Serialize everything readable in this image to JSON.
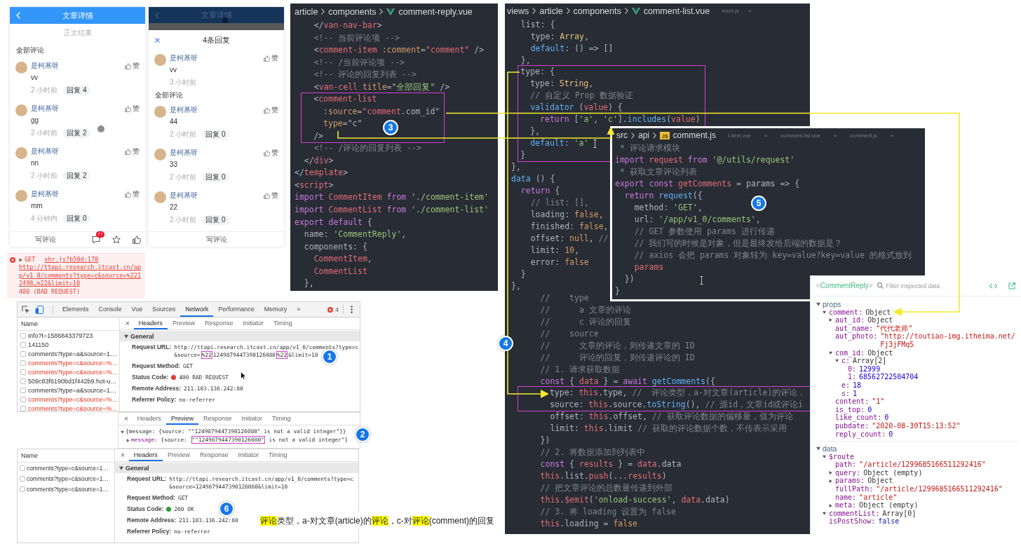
{
  "phone_article": {
    "title": "文章详情",
    "end_note": "正文结束",
    "section_title": "全部评论",
    "comments": [
      {
        "author": "是柯基呀",
        "like": "赞",
        "content": "vv",
        "time": "2 小时前",
        "reply": "回复 4"
      },
      {
        "author": "是柯基呀",
        "like": "赞",
        "content": "gg",
        "time": "2 小时前",
        "reply": "回复 2"
      },
      {
        "author": "是柯基呀",
        "like": "赞",
        "content": "nn",
        "time": "2 小时前",
        "reply": "回复 2"
      },
      {
        "author": "是柯基呀",
        "like": "赞",
        "content": "mm",
        "time": "4 分钟内",
        "reply": "回复 0"
      }
    ],
    "bottom_bar": {
      "write": "写评论",
      "comment_count": "77"
    }
  },
  "phone_replies": {
    "title": "文章详情",
    "popup_title": "4条回复",
    "current_comment": {
      "author": "是柯基呀",
      "like": "赞",
      "content": "vv",
      "time": "3 小时前"
    },
    "section_title": "全部评论",
    "replies": [
      {
        "author": "是柯基呀",
        "like": "赞",
        "content": "44",
        "time": "2 小时前",
        "reply": "回复 0"
      },
      {
        "author": "是柯基呀",
        "like": "赞",
        "content": "33",
        "time": "2 小时前",
        "reply": "回复 0"
      },
      {
        "author": "是柯基呀",
        "like": "赞",
        "content": "22",
        "time": "2 小时前",
        "reply": "回复 0"
      }
    ],
    "bottom_bar": {
      "write": "写评论"
    }
  },
  "console_error": {
    "expanded": false,
    "method": "GET",
    "source": "xhr.js?b50d:178",
    "url": "http://ttapi.research.itcast.cn/app/v1_0/comments?type=c&source=%2212498…%22&limit=10",
    "status": "400 (BAD REQUEST)"
  },
  "network_failed": {
    "tools": [
      {
        "label": "Elements",
        "selected": false
      },
      {
        "label": "Console",
        "selected": false
      },
      {
        "label": "Vue",
        "selected": false
      },
      {
        "label": "Sources",
        "selected": false
      },
      {
        "label": "Network",
        "selected": true
      },
      {
        "label": "Performance",
        "selected": false
      },
      {
        "label": "Memory",
        "selected": false
      }
    ],
    "more": "»",
    "error_count": "4",
    "name_header": "Name",
    "requests": [
      {
        "name": "info?t=1586843379723",
        "failed": false
      },
      {
        "name": "141150",
        "failed": false
      },
      {
        "name": "comments?type=a&source=1…",
        "failed": false
      },
      {
        "name": "comments?type=c&source=%…",
        "failed": true
      },
      {
        "name": "comments?type=c&source=%…",
        "failed": true
      },
      {
        "name": "509c83f6190bd1f442b9.hot-u…",
        "failed": false
      },
      {
        "name": "comments?type=a&source=1…",
        "failed": false
      },
      {
        "name": "comments?type=c&source=%…",
        "failed": true
      },
      {
        "name": "comments?type=c&source=%…",
        "failed": true
      }
    ],
    "close": "×",
    "detail_tabs": [
      {
        "label": "Headers",
        "selected": true
      },
      {
        "label": "Preview",
        "selected": false
      },
      {
        "label": "Response",
        "selected": false
      },
      {
        "label": "Initiator",
        "selected": false
      },
      {
        "label": "Timing",
        "selected": false
      }
    ],
    "general": {
      "title": "General",
      "expanded": true,
      "rows": [
        {
          "kind": "text",
          "label": "Request URL:",
          "value": [
            {
              "text": "http://ttapi.research.itcast.cn/app/v1_0/comments?type=c&source=",
              "highlight": false
            },
            {
              "text": "%22",
              "highlight": true
            },
            {
              "text": "1249879447390126080",
              "highlight": false
            },
            {
              "text": "%22",
              "highlight": true
            },
            {
              "text": "&limit=10",
              "highlight": false
            }
          ]
        },
        {
          "kind": "text",
          "label": "Request Method:",
          "value": [
            {
              "text": "GET",
              "highlight": false
            }
          ]
        },
        {
          "kind": "status",
          "label": "Status Code:",
          "color": "#e53935",
          "value": [
            {
              "text": "400 BAD REQUEST",
              "highlight": false
            }
          ]
        },
        {
          "kind": "text",
          "label": "Remote Address:",
          "value": [
            {
              "text": "211.103.136.242:80",
              "highlight": false
            }
          ]
        },
        {
          "kind": "text",
          "label": "Referrer Policy:",
          "value": [
            {
              "text": "no-referrer",
              "highlight": false
            }
          ]
        }
      ]
    }
  },
  "preview": {
    "close": "×",
    "detail_tabs": [
      {
        "label": "Headers",
        "selected": false
      },
      {
        "label": "Preview",
        "selected": true
      },
      {
        "label": "Response",
        "selected": false
      },
      {
        "label": "Initiator",
        "selected": false
      },
      {
        "label": "Timing",
        "selected": false
      }
    ],
    "lines": [
      {
        "expanded": true,
        "parts": [
          {
            "kind": "plain",
            "text": "{message: {source: \"\"1249879447390126080\" is not a valid integer\"}}",
            "highlight": false
          }
        ],
        "children": [
          {
            "expanded": false,
            "parts": [
              {
                "kind": "key",
                "text": "message",
                "highlight": false
              },
              {
                "kind": "plain",
                "text": ": {source: ",
                "highlight": false
              },
              {
                "kind": "plain",
                "text": "\"\"1249879447390126080\"",
                "highlight": true
              },
              {
                "kind": "plain",
                "text": " is not a valid integer\"}",
                "highlight": false
              }
            ]
          }
        ]
      }
    ]
  },
  "network_ok": {
    "name_header": "Name",
    "requests": [
      {
        "name": "comments?type=c&source=1…",
        "failed": false
      },
      {
        "name": "comments?type=c&source=1…",
        "failed": false
      },
      {
        "name": "comments?type=c&source=1…",
        "failed": false
      }
    ],
    "close": "×",
    "detail_tabs": [
      {
        "label": "Headers",
        "selected": true
      },
      {
        "label": "Preview",
        "selected": false
      },
      {
        "label": "Response",
        "selected": false
      },
      {
        "label": "Initiator",
        "selected": false
      },
      {
        "label": "Timing",
        "selected": false
      }
    ],
    "general": {
      "title": "General",
      "expanded": true,
      "rows": [
        {
          "kind": "text",
          "label": "Request URL:",
          "value": [
            {
              "text": "http://ttapi.research.itcast.cn/app/v1_0/comments?type=c&source=1249879447390126080&limit=10",
              "highlight": false
            }
          ]
        },
        {
          "kind": "text",
          "label": "Request Method:",
          "value": [
            {
              "text": "GET",
              "highlight": false
            }
          ]
        },
        {
          "kind": "status",
          "label": "Status Code:",
          "color": "#2e9d3a",
          "value": [
            {
              "text": "200 OK",
              "highlight": false
            }
          ]
        },
        {
          "kind": "text",
          "label": "Remote Address:",
          "value": [
            {
              "text": "211.103.136.242:80",
              "highlight": false
            }
          ]
        },
        {
          "kind": "text",
          "label": "Referrer Policy:",
          "value": [
            {
              "text": "no-referrer",
              "highlight": false
            }
          ]
        }
      ]
    }
  },
  "editor_reply": {
    "path": [
      "article",
      "components"
    ],
    "file_icon": {
      "kind": "vue"
    },
    "file": "comment-reply.vue",
    "blocks": [
      {
        "highlighted": false,
        "lines": [
          [
            {
              "kind": "p",
              "text": "    </"
            },
            {
              "kind": "t",
              "text": "van-nav-bar"
            },
            {
              "kind": "p",
              "text": ">"
            }
          ],
          [
            {
              "kind": "c",
              "text": "    <!-- 当前评论项 -->"
            }
          ],
          [
            {
              "kind": "p",
              "text": "    <"
            },
            {
              "kind": "t",
              "text": "comment-item"
            },
            {
              "kind": "a",
              "text": " :comment"
            },
            {
              "kind": "p",
              "text": "="
            },
            {
              "kind": "v",
              "text": "\"comment\""
            },
            {
              "kind": "p",
              "text": " />"
            }
          ],
          [
            {
              "kind": "c",
              "text": "    <!-- /当前评论项 -->"
            }
          ],
          [
            {
              "kind": "c",
              "text": "    <!-- 评论的回复列表 -->"
            }
          ],
          [
            {
              "kind": "p",
              "text": "    <"
            },
            {
              "kind": "t",
              "text": "van-cell"
            },
            {
              "kind": "a",
              "text": " title"
            },
            {
              "kind": "p",
              "text": "="
            },
            {
              "kind": "s",
              "text": "\"全部回复\""
            },
            {
              "kind": "p",
              "text": " />"
            }
          ]
        ]
      },
      {
        "highlighted": true,
        "lines": [
          [
            {
              "kind": "p",
              "text": "    <"
            },
            {
              "kind": "t",
              "text": "comment-list"
            }
          ],
          [
            {
              "kind": "a",
              "text": "      :source"
            },
            {
              "kind": "p",
              "text": "="
            },
            {
              "kind": "v",
              "text": "\"comment"
            },
            {
              "kind": "p",
              "text": ".com_id\""
            }
          ],
          [
            {
              "kind": "a",
              "text": "      type"
            },
            {
              "kind": "p",
              "text": "=\"c\""
            }
          ],
          [
            {
              "kind": "p",
              "text": "    />"
            }
          ]
        ]
      },
      {
        "highlighted": false,
        "lines": [
          [
            {
              "kind": "c",
              "text": "    <!-- /评论的回复列表 -->"
            }
          ],
          [
            {
              "kind": "p",
              "text": "  </"
            },
            {
              "kind": "t",
              "text": "div"
            },
            {
              "kind": "p",
              "text": ">"
            }
          ],
          [
            {
              "kind": "p",
              "text": "</"
            },
            {
              "kind": "t",
              "text": "template"
            },
            {
              "kind": "p",
              "text": ">"
            }
          ],
          [
            {
              "kind": "p",
              "text": "<"
            },
            {
              "kind": "t",
              "text": "script"
            },
            {
              "kind": "p",
              "text": ">"
            }
          ],
          [
            {
              "kind": "k",
              "text": "import "
            },
            {
              "kind": "v",
              "text": "CommentItem"
            },
            {
              "kind": "k",
              "text": " from "
            },
            {
              "kind": "s",
              "text": "'./comment-item'"
            }
          ],
          [
            {
              "kind": "k",
              "text": "import "
            },
            {
              "kind": "v",
              "text": "CommentList"
            },
            {
              "kind": "k",
              "text": " from "
            },
            {
              "kind": "s",
              "text": "'./comment-list'"
            }
          ],
          [
            {
              "kind": "k",
              "text": "export default"
            },
            {
              "kind": "p",
              "text": " {"
            }
          ],
          [
            {
              "kind": "p",
              "text": "  name: "
            },
            {
              "kind": "s",
              "text": "'CommentReply'"
            },
            {
              "kind": "p",
              "text": ","
            }
          ],
          [
            {
              "kind": "p",
              "text": "  components: {"
            }
          ],
          [
            {
              "kind": "v",
              "text": "    CommentItem"
            },
            {
              "kind": "p",
              "text": ","
            }
          ],
          [
            {
              "kind": "v",
              "text": "    CommentList"
            }
          ],
          [
            {
              "kind": "p",
              "text": "  },"
            }
          ]
        ]
      }
    ]
  },
  "editor_list": {
    "path": [
      "views",
      "article",
      "components"
    ],
    "file_icon": {
      "kind": "vue"
    },
    "file": "comment-list.vue",
    "faded_tabs": [
      "ment.js",
      "×"
    ],
    "blocks": [
      {
        "highlighted": false,
        "lines": [
          [
            {
              "kind": "p",
              "text": "  list: {"
            }
          ],
          [
            {
              "kind": "p",
              "text": "    type: "
            },
            {
              "kind": "y",
              "text": "Array"
            },
            {
              "kind": "p",
              "text": ","
            }
          ],
          [
            {
              "kind": "f",
              "text": "    default"
            },
            {
              "kind": "p",
              "text": ": () => []"
            }
          ],
          [
            {
              "kind": "p",
              "text": "  },"
            }
          ]
        ]
      },
      {
        "highlighted": true,
        "lines": [
          [
            {
              "kind": "p",
              "text": "  type: {"
            }
          ],
          [
            {
              "kind": "p",
              "text": "    type: "
            },
            {
              "kind": "y",
              "text": "String"
            },
            {
              "kind": "p",
              "text": ","
            }
          ],
          [
            {
              "kind": "c",
              "text": "    // 自定义 Prop 数据验证"
            }
          ],
          [
            {
              "kind": "f",
              "text": "    validator"
            },
            {
              "kind": "p",
              "text": " ("
            },
            {
              "kind": "v",
              "text": "value"
            },
            {
              "kind": "p",
              "text": ") {"
            }
          ],
          [
            {
              "kind": "k",
              "text": "      return"
            },
            {
              "kind": "p",
              "text": " ["
            },
            {
              "kind": "s",
              "text": "'a'"
            },
            {
              "kind": "p",
              "text": ", "
            },
            {
              "kind": "s",
              "text": "'c'"
            },
            {
              "kind": "p",
              "text": "]."
            },
            {
              "kind": "f",
              "text": "includes"
            },
            {
              "kind": "p",
              "text": "("
            },
            {
              "kind": "v",
              "text": "value"
            },
            {
              "kind": "p",
              "text": ")"
            }
          ],
          [
            {
              "kind": "p",
              "text": "    },"
            }
          ],
          [
            {
              "kind": "f",
              "text": "    default"
            },
            {
              "kind": "p",
              "text": ": "
            },
            {
              "kind": "s",
              "text": "'a'"
            }
          ],
          [
            {
              "kind": "p",
              "text": "  }"
            }
          ]
        ]
      },
      {
        "highlighted": false,
        "lines": [
          [
            {
              "kind": "p",
              "text": "},"
            }
          ],
          [
            {
              "kind": "f",
              "text": "data"
            },
            {
              "kind": "p",
              "text": " () {"
            }
          ],
          [
            {
              "kind": "k",
              "text": "  return"
            },
            {
              "kind": "p",
              "text": " {"
            }
          ],
          [
            {
              "kind": "c",
              "text": "    // list: [],"
            }
          ],
          [
            {
              "kind": "p",
              "text": "    loading: "
            },
            {
              "kind": "n",
              "text": "false"
            },
            {
              "kind": "p",
              "text": ","
            }
          ],
          [
            {
              "kind": "p",
              "text": "    finished: "
            },
            {
              "kind": "n",
              "text": "false"
            },
            {
              "kind": "p",
              "text": ","
            }
          ],
          [
            {
              "kind": "p",
              "text": "    offset: "
            },
            {
              "kind": "n",
              "text": "null"
            },
            {
              "kind": "p",
              "text": ", "
            },
            {
              "kind": "c",
              "text": "//"
            }
          ],
          [
            {
              "kind": "p",
              "text": "    limit: "
            },
            {
              "kind": "n",
              "text": "10"
            },
            {
              "kind": "p",
              "text": ","
            }
          ],
          [
            {
              "kind": "p",
              "text": "    error: "
            },
            {
              "kind": "n",
              "text": "false"
            }
          ],
          [
            {
              "kind": "p",
              "text": "  }"
            }
          ],
          [
            {
              "kind": "p",
              "text": "},"
            }
          ],
          [
            {
              "kind": "c",
              "text": "      //    type"
            }
          ],
          [
            {
              "kind": "c",
              "text": "      //      a 文章的评论"
            }
          ],
          [
            {
              "kind": "c",
              "text": "      //      c 评论的回复"
            }
          ],
          [
            {
              "kind": "c",
              "text": "      //    source"
            }
          ],
          [
            {
              "kind": "c",
              "text": "      //      文章的评论，则传递文章的 ID"
            }
          ],
          [
            {
              "kind": "c",
              "text": "      //      评论的回复，则传递评论的 ID"
            }
          ],
          [
            {
              "kind": "c",
              "text": "      // 1. 请求获取数据"
            }
          ],
          [
            {
              "kind": "k",
              "text": "      const"
            },
            {
              "kind": "p",
              "text": " { "
            },
            {
              "kind": "v",
              "text": "data"
            },
            {
              "kind": "p",
              "text": " } = "
            },
            {
              "kind": "k",
              "text": "await "
            },
            {
              "kind": "f",
              "text": "getComments"
            },
            {
              "kind": "p",
              "text": "({"
            }
          ]
        ]
      },
      {
        "highlighted": true,
        "lines": [
          [
            {
              "kind": "p",
              "text": "        type: "
            },
            {
              "kind": "v",
              "text": "this"
            },
            {
              "kind": "p",
              "text": ".type, "
            },
            {
              "kind": "c",
              "text": "//  评论类型，a-对文章(article)的评论，"
            }
          ],
          [
            {
              "kind": "p",
              "text": "        source: "
            },
            {
              "kind": "v",
              "text": "this"
            },
            {
              "kind": "p",
              "text": ".source."
            },
            {
              "kind": "f",
              "text": "toString"
            },
            {
              "kind": "p",
              "text": "(), "
            },
            {
              "kind": "c",
              "text": "// 源id，文章id或评论i"
            }
          ]
        ]
      },
      {
        "highlighted": false,
        "lines": [
          [
            {
              "kind": "p",
              "text": "        offset: "
            },
            {
              "kind": "v",
              "text": "this"
            },
            {
              "kind": "p",
              "text": ".offset, "
            },
            {
              "kind": "c",
              "text": "// 获取评论数据的偏移量，值为评论"
            }
          ],
          [
            {
              "kind": "p",
              "text": "        limit: "
            },
            {
              "kind": "v",
              "text": "this"
            },
            {
              "kind": "p",
              "text": ".limit "
            },
            {
              "kind": "c",
              "text": "// 获取的评论数据个数，不传表示采用"
            }
          ],
          [
            {
              "kind": "p",
              "text": "      })"
            }
          ],
          [
            {
              "kind": "c",
              "text": "      // 2. 将数据添加到列表中"
            }
          ],
          [
            {
              "kind": "k",
              "text": "      const"
            },
            {
              "kind": "p",
              "text": " { "
            },
            {
              "kind": "v",
              "text": "results"
            },
            {
              "kind": "p",
              "text": " } = "
            },
            {
              "kind": "v",
              "text": "data"
            },
            {
              "kind": "p",
              "text": ".data"
            }
          ],
          [
            {
              "kind": "v",
              "text": "      this"
            },
            {
              "kind": "p",
              "text": ".list."
            },
            {
              "kind": "v",
              "text": "push"
            },
            {
              "kind": "p",
              "text": "(..."
            },
            {
              "kind": "v",
              "text": "results"
            },
            {
              "kind": "p",
              "text": ")"
            }
          ],
          [
            {
              "kind": "c",
              "text": "      // 把文章评论的总数量传递到外部"
            }
          ],
          [
            {
              "kind": "v",
              "text": "      this"
            },
            {
              "kind": "p",
              "text": "."
            },
            {
              "kind": "v",
              "text": "$emit"
            },
            {
              "kind": "p",
              "text": "("
            },
            {
              "kind": "s",
              "text": "'onload-success'"
            },
            {
              "kind": "p",
              "text": ", "
            },
            {
              "kind": "v",
              "text": "data"
            },
            {
              "kind": "p",
              "text": ".data)"
            }
          ],
          [
            {
              "kind": "c",
              "text": "      // 3. 将 loading 设置为 false"
            }
          ],
          [
            {
              "kind": "v",
              "text": "      this"
            },
            {
              "kind": "p",
              "text": ".loading = "
            },
            {
              "kind": "n",
              "text": "false"
            }
          ]
        ]
      }
    ]
  },
  "editor_api": {
    "path": [
      "src",
      "api"
    ],
    "file_icon": {
      "kind": "js",
      "label": "JS"
    },
    "file": "comment.js",
    "faded_tabs": [
      "t-item.vue",
      "×",
      "comment-list.vue",
      "×",
      "comment.js",
      "×"
    ],
    "blocks": [
      {
        "highlighted": false,
        "lines": [
          [
            {
              "kind": "c",
              "text": " * 评论请求模块"
            }
          ],
          [
            {
              "kind": "k",
              "text": "import "
            },
            {
              "kind": "v",
              "text": "request"
            },
            {
              "kind": "k",
              "text": " from "
            },
            {
              "kind": "s",
              "text": "'@/utils/request'"
            }
          ],
          [
            {
              "kind": "c",
              "text": " * 获取文章评论列表"
            }
          ],
          [
            {
              "kind": "k",
              "text": "export const "
            },
            {
              "kind": "v",
              "text": "getComments"
            },
            {
              "kind": "p",
              "text": " = params => {"
            }
          ],
          [
            {
              "kind": "k",
              "text": "  return "
            },
            {
              "kind": "f",
              "text": "request"
            },
            {
              "kind": "p",
              "text": "({"
            }
          ],
          [
            {
              "kind": "p",
              "text": "    method: "
            },
            {
              "kind": "s",
              "text": "'GET'"
            },
            {
              "kind": "p",
              "text": ","
            }
          ],
          [
            {
              "kind": "p",
              "text": "    url: "
            },
            {
              "kind": "s",
              "text": "'/app/v1_0/comments'"
            },
            {
              "kind": "p",
              "text": ","
            }
          ],
          [
            {
              "kind": "c",
              "text": "    // GET 参数使用 params 进行传递"
            }
          ],
          [
            {
              "kind": "c",
              "text": "    // 我们写的时候是对象，但是最终发给后端的数据是？"
            }
          ],
          [
            {
              "kind": "c",
              "text": "    // axios 会把 params 对象转为 key=value?key=value 的格式放到"
            }
          ],
          [
            {
              "kind": "v",
              "text": "    params"
            }
          ],
          [
            {
              "kind": "p",
              "text": "  })"
            }
          ],
          [
            {
              "kind": "p",
              "text": "}"
            }
          ]
        ]
      }
    ]
  },
  "vue_inspector": {
    "component": {
      "open": "<",
      "name": "CommentReply",
      "close": ">"
    },
    "filter_placeholder": "Filter inspected data",
    "sections": [
      {
        "title": "props",
        "expanded": true,
        "nodes": [
          {
            "key": "comment:",
            "value": "Object",
            "kind": "object",
            "expanded": true,
            "children": [
              {
                "key": "aut_id:",
                "value": "Object",
                "kind": "object",
                "expanded": false
              },
              {
                "key": "aut_name:",
                "value": "\"代代老师\"",
                "kind": "string"
              },
              {
                "key": "aut_photo:",
                "value": "\"http://toutiao-img.itheima.net/Fj3jFMq5",
                "kind": "string"
              },
              {
                "key": "com_id:",
                "value": "Object",
                "kind": "object",
                "expanded": true,
                "children": [
                  {
                    "key": "c:",
                    "value": "Array[2]",
                    "kind": "object",
                    "expanded": true,
                    "children": [
                      {
                        "key": "0:",
                        "value": "12999",
                        "kind": "number"
                      },
                      {
                        "key": "1:",
                        "value": "68562722504704",
                        "kind": "number"
                      }
                    ]
                  },
                  {
                    "key": "e:",
                    "value": "18",
                    "kind": "number"
                  },
                  {
                    "key": "s:",
                    "value": "1",
                    "kind": "number"
                  }
                ]
              },
              {
                "key": "content:",
                "value": "\"1\"",
                "kind": "string"
              },
              {
                "key": "is_top:",
                "value": "0",
                "kind": "number"
              },
              {
                "key": "like_count:",
                "value": "0",
                "kind": "number"
              },
              {
                "key": "pubdate:",
                "value": "\"2020-08-30T15:13:52\"",
                "kind": "string"
              },
              {
                "key": "reply_count:",
                "value": "0",
                "kind": "number"
              }
            ]
          }
        ]
      },
      {
        "title": "data",
        "expanded": true,
        "nodes": [
          {
            "key": "$route",
            "expanded": true,
            "children": [
              {
                "key": "path:",
                "value": "\"/article/1299685166511292416\"",
                "kind": "string"
              },
              {
                "key": "query:",
                "value": "Object (empty)",
                "kind": "object",
                "expanded": false
              },
              {
                "key": "params:",
                "value": "Object",
                "kind": "object",
                "expanded": false
              },
              {
                "key": "fullPath:",
                "value": "\"/article/1299685166511292416\"",
                "kind": "string"
              },
              {
                "key": "name:",
                "value": "\"article\"",
                "kind": "string"
              },
              {
                "key": "meta:",
                "value": "Object (empty)",
                "kind": "object",
                "expanded": false
              }
            ]
          },
          {
            "key": "commentList:",
            "value": "Array[0]",
            "kind": "object",
            "expanded": true
          },
          {
            "key": "isPostShow:",
            "value": "false",
            "kind": "boolean"
          }
        ]
      }
    ]
  },
  "caption": {
    "parts": [
      {
        "text": "评论",
        "highlight": true
      },
      {
        "text": "类型，a-对文章(article)的",
        "highlight": false
      },
      {
        "text": "评论",
        "highlight": true
      },
      {
        "text": "，c-对",
        "highlight": false
      },
      {
        "text": "评论",
        "highlight": true
      },
      {
        "text": "(comment)的回复",
        "highlight": false
      }
    ]
  },
  "step_badges": [
    "1",
    "2",
    "3",
    "4",
    "5",
    "6"
  ]
}
